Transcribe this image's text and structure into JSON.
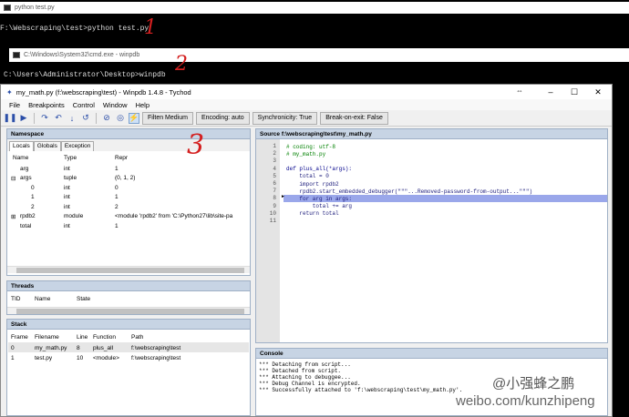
{
  "console1": {
    "title": "python test.py",
    "lines": [
      "F:\\Webscraping\\test>python test.py"
    ]
  },
  "console2": {
    "title": "C:\\Windows\\System32\\cmd.exe - winpdb",
    "lines": [
      "C:\\Users\\Administrator\\Desktop>winpdb"
    ]
  },
  "window": {
    "title": "my_math.py (f:\\webscraping\\test) - Winpdb 1.4.8 - Tychod",
    "extra_icon": "⇔"
  },
  "menu": [
    "File",
    "Breakpoints",
    "Control",
    "Window",
    "Help"
  ],
  "toolbar": {
    "icons": [
      "pause-icon",
      "play-icon",
      "step-over-icon",
      "step-into-icon",
      "step-return-icon",
      "jump-icon",
      "goto-icon",
      "analyze-icon",
      "lightning-icon"
    ],
    "glyphs": [
      "❚❚",
      "▶",
      "↷",
      "↶",
      "↓",
      "↺",
      "⊘",
      "◎",
      "⚡"
    ],
    "filter": "Filten Medium",
    "encoding": "Encoding: auto",
    "synchronicity": "Synchronicity: True",
    "break_on_exit": "Break-on-exit: False"
  },
  "namespace": {
    "title": "Namespace",
    "tabs": [
      "Locals",
      "Globals",
      "Exception"
    ],
    "columns": [
      "Name",
      "Type",
      "Repr"
    ],
    "rows": [
      {
        "name": "arg",
        "type": "int",
        "repr": "1",
        "indent": 0,
        "expander": ""
      },
      {
        "name": "args",
        "type": "tuple",
        "repr": "(0, 1, 2)",
        "indent": 0,
        "expander": "⊟"
      },
      {
        "name": "0",
        "type": "int",
        "repr": "0",
        "indent": 1,
        "expander": ""
      },
      {
        "name": "1",
        "type": "int",
        "repr": "1",
        "indent": 1,
        "expander": ""
      },
      {
        "name": "2",
        "type": "int",
        "repr": "2",
        "indent": 1,
        "expander": ""
      },
      {
        "name": "rpdb2",
        "type": "module",
        "repr": "<module 'rpdb2' from 'C:\\Python27\\lib\\site-pa",
        "indent": 0,
        "expander": "⊞"
      },
      {
        "name": "total",
        "type": "int",
        "repr": "1",
        "indent": 0,
        "expander": ""
      }
    ]
  },
  "threads": {
    "title": "Threads",
    "columns": [
      "TID",
      "Name",
      "State"
    ]
  },
  "stack": {
    "title": "Stack",
    "columns": [
      "Frame",
      "Filename",
      "Line",
      "Function",
      "Path"
    ],
    "rows": [
      {
        "frame": "0",
        "filename": "my_math.py",
        "line": "8",
        "function": "plus_all",
        "path": "f:\\webscraping\\test"
      },
      {
        "frame": "1",
        "filename": "test.py",
        "line": "10",
        "function": "<module>",
        "path": "f:\\webscraping\\test"
      }
    ]
  },
  "source": {
    "title": "Source f:\\webscraping\\test\\my_math.py",
    "lines": [
      {
        "n": "1",
        "text": "# coding: utf-8",
        "cls": "cm"
      },
      {
        "n": "2",
        "text": "# my_math.py",
        "cls": "cm"
      },
      {
        "n": "3",
        "text": "",
        "cls": ""
      },
      {
        "n": "4",
        "text": "def plus_all(*args):",
        "cls": "kw"
      },
      {
        "n": "5",
        "text": "    total = 0",
        "cls": ""
      },
      {
        "n": "6",
        "text": "    import rpdb2",
        "cls": ""
      },
      {
        "n": "7",
        "text": "    rpdb2.start_embedded_debugger(\"\"\"...Removed-password-from-output...\"\"\")",
        "cls": ""
      },
      {
        "n": "8",
        "text": "    for arg in args:",
        "cls": "hl"
      },
      {
        "n": "9",
        "text": "        total += arg",
        "cls": ""
      },
      {
        "n": "10",
        "text": "    return total",
        "cls": ""
      },
      {
        "n": "11",
        "text": "",
        "cls": ""
      }
    ],
    "current_marker": "►"
  },
  "console": {
    "title": "Console",
    "lines": [
      "*** Detaching from script...",
      "*** Detached from script.",
      "*** Attaching to debuggee...",
      "*** Debug Channel is encrypted.",
      "*** Successfully attached to 'f:\\webscraping\\test\\my_math.py'."
    ]
  },
  "annotations": [
    "1",
    "2",
    "3"
  ],
  "watermark": {
    "handle": "@小强蜂之鹏",
    "url": "weibo.com/kunzhipeng"
  },
  "colors": {
    "pane_header": "#c7d4e4",
    "highlight_line": "#9aa7ea",
    "annotation": "#d42020"
  }
}
